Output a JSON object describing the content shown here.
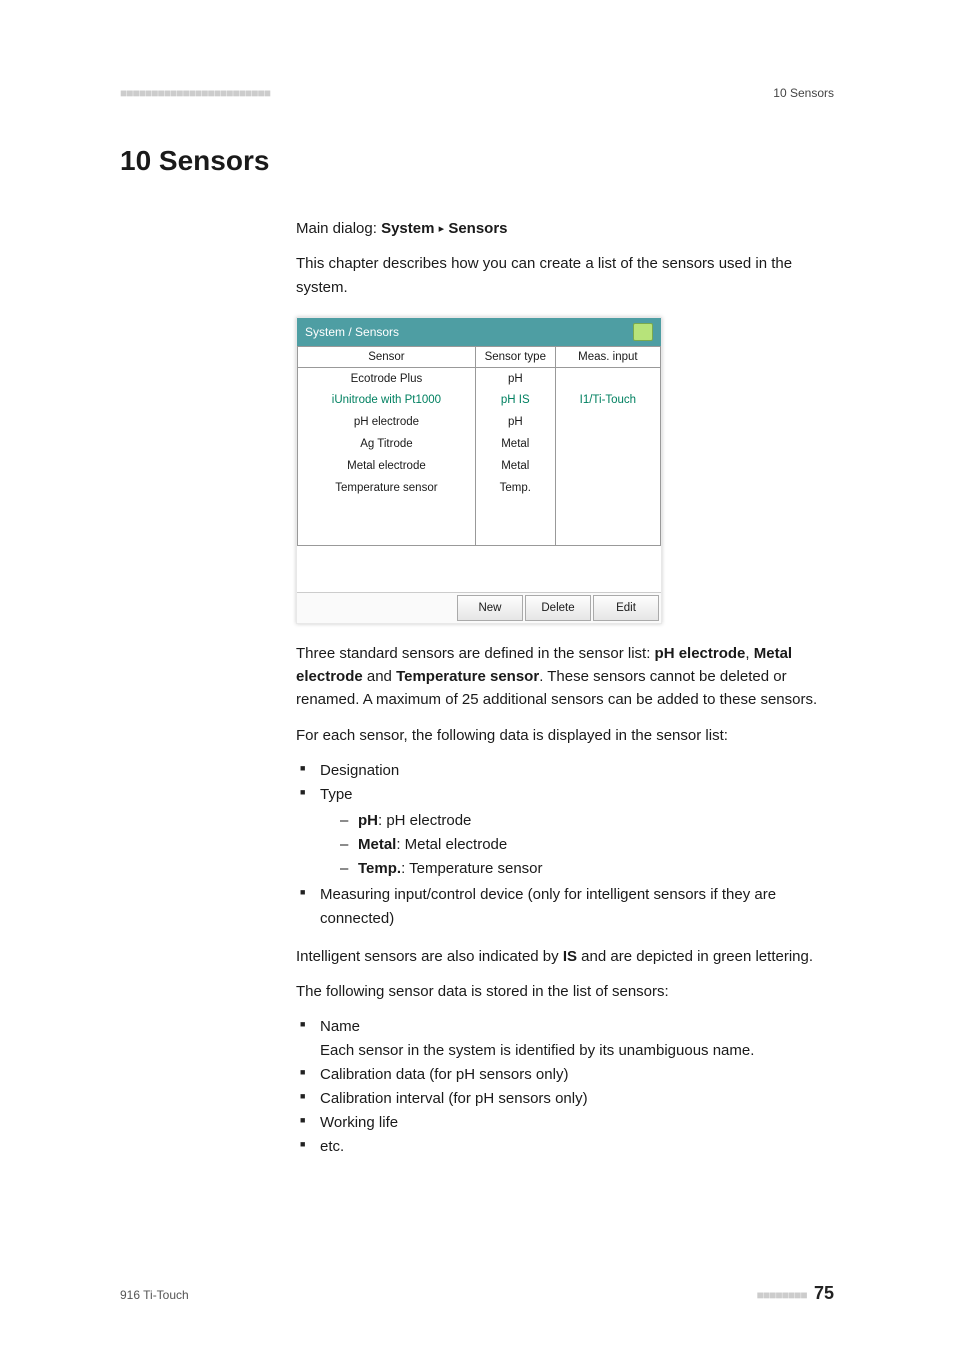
{
  "header": {
    "left_marker": "■■■■■■■■■■■■■■■■■■■■■■■■",
    "right_label": "10 Sensors"
  },
  "title": "10 Sensors",
  "intro": {
    "breadcrumb_prefix": "Main dialog: ",
    "breadcrumb_b1": "System",
    "breadcrumb_sep": "▸",
    "breadcrumb_b2": "Sensors",
    "para1": "This chapter describes how you can create a list of the sensors used in the system."
  },
  "app": {
    "titlebar": "System / Sensors",
    "columns": {
      "c1": "Sensor",
      "c2": "Sensor type",
      "c3": "Meas. input"
    },
    "rows": [
      {
        "sensor": "Ecotrode Plus",
        "type": "pH",
        "meas": "",
        "intelligent": false
      },
      {
        "sensor": "iUnitrode with Pt1000",
        "type": "pH IS",
        "meas": "I1/Ti-Touch",
        "intelligent": true
      },
      {
        "sensor": "pH electrode",
        "type": "pH",
        "meas": "",
        "intelligent": false
      },
      {
        "sensor": "Ag Titrode",
        "type": "Metal",
        "meas": "",
        "intelligent": false
      },
      {
        "sensor": "Metal electrode",
        "type": "Metal",
        "meas": "",
        "intelligent": false
      },
      {
        "sensor": "Temperature sensor",
        "type": "Temp.",
        "meas": "",
        "intelligent": false
      }
    ],
    "buttons": {
      "new": "New",
      "delete": "Delete",
      "edit": "Edit"
    }
  },
  "para_after_app": {
    "t1": "Three standard sensors are defined in the sensor list: ",
    "b1": "pH electrode",
    "t2": ", ",
    "b2": "Metal electrode",
    "t3": " and ",
    "b3": "Temperature sensor",
    "t4": ". These sensors cannot be deleted or renamed. A maximum of 25 additional sensors can be added to these sensors."
  },
  "list_intro": "For each sensor, the following data is displayed in the sensor list:",
  "list1": {
    "i1": "Designation",
    "i2": "Type",
    "sub_ph_b": "pH",
    "sub_ph_t": ": pH electrode",
    "sub_metal_b": "Metal",
    "sub_metal_t": ": Metal electrode",
    "sub_temp_b": "Temp.",
    "sub_temp_t": ": Temperature sensor",
    "i3": "Measuring input/control device (only for intelligent sensors if they are connected)"
  },
  "para_is": {
    "t1": "Intelligent sensors are also indicated by ",
    "b1": "IS",
    "t2": " and are depicted in green lettering."
  },
  "list2_intro": "The following sensor data is stored in the list of sensors:",
  "list2": {
    "i1": "Name",
    "i1_sub": "Each sensor in the system is identified by its unambiguous name.",
    "i2": "Calibration data (for pH sensors only)",
    "i3": "Calibration interval (for pH sensors only)",
    "i4": "Working life",
    "i5": "etc."
  },
  "footer": {
    "left": "916 Ti-Touch",
    "bars": "■■■■■■■■",
    "page": "75"
  }
}
